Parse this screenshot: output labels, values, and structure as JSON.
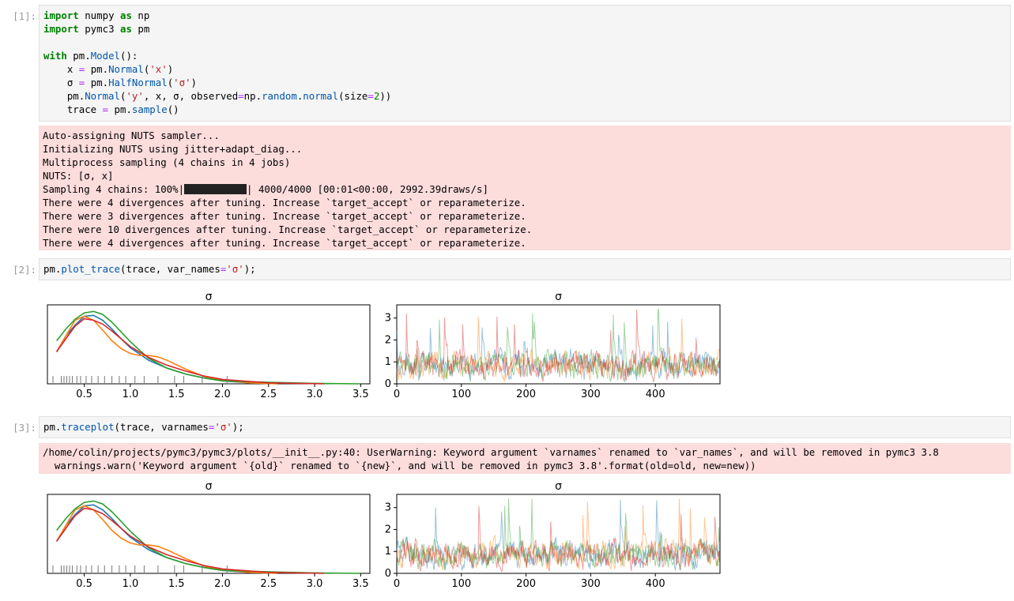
{
  "cells": [
    {
      "prompt": "[1]:",
      "code": [
        "import numpy as np",
        "import pymc3 as pm",
        "",
        "with pm.Model():",
        "    x = pm.Normal('x')",
        "    σ = pm.HalfNormal('σ')",
        "    pm.Normal('y', x, σ, observed=np.random.normal(size=2))",
        "    trace = pm.sample()"
      ],
      "stderr": [
        "Auto-assigning NUTS sampler...",
        "Initializing NUTS using jitter+adapt_diag...",
        "Multiprocess sampling (4 chains in 4 jobs)",
        "NUTS: [σ, x]",
        "Sampling 4 chains: 100%|",
        "| 4000/4000 [00:01<00:00, 2992.39draws/s]",
        "There were 4 divergences after tuning. Increase `target_accept` or reparameterize.",
        "There were 3 divergences after tuning. Increase `target_accept` or reparameterize.",
        "There were 10 divergences after tuning. Increase `target_accept` or reparameterize.",
        "There were 4 divergences after tuning. Increase `target_accept` or reparameterize."
      ]
    },
    {
      "prompt": "[2]:",
      "code": [
        "pm.plot_trace(trace, var_names='σ');"
      ]
    },
    {
      "prompt": "[3]:",
      "code": [
        "pm.traceplot(trace, varnames='σ');"
      ],
      "stderr": [
        "/home/colin/projects/pymc3/pymc3/plots/__init__.py:40: UserWarning: Keyword argument `varnames` renamed to `var_names`, and will be removed in pymc3 3.8",
        "  warnings.warn('Keyword argument `{old}` renamed to `{new}`, and will be removed in pymc3 3.8'.format(old=old, new=new))"
      ]
    }
  ],
  "chart_data": [
    {
      "type": "line",
      "title": "σ",
      "xlabel": "",
      "ylabel": "",
      "xticks": [
        "0.5",
        "1.0",
        "1.5",
        "2.0",
        "2.5",
        "3.0",
        "3.5"
      ],
      "xlim": [
        0.1,
        3.6
      ],
      "series_colors": [
        "#1f77b4",
        "#ff7f0e",
        "#2ca02c",
        "#d62728"
      ],
      "series": [
        {
          "x": [
            0.2,
            0.3,
            0.4,
            0.5,
            0.6,
            0.7,
            0.8,
            0.9,
            1.0,
            1.2,
            1.4,
            1.6,
            1.8,
            2.0,
            2.3,
            2.6
          ],
          "y": [
            0.65,
            0.98,
            1.2,
            1.38,
            1.4,
            1.3,
            1.12,
            0.92,
            0.74,
            0.48,
            0.32,
            0.2,
            0.12,
            0.06,
            0.02,
            0.0
          ]
        },
        {
          "x": [
            0.2,
            0.3,
            0.4,
            0.5,
            0.6,
            0.7,
            0.8,
            0.9,
            1.0,
            1.1,
            1.2,
            1.3,
            1.4,
            1.6,
            1.8,
            2.0,
            2.3,
            2.6
          ],
          "y": [
            0.65,
            0.98,
            1.3,
            1.38,
            1.3,
            1.1,
            0.88,
            0.72,
            0.62,
            0.58,
            0.58,
            0.55,
            0.48,
            0.3,
            0.15,
            0.07,
            0.02,
            0.0
          ]
        },
        {
          "x": [
            0.2,
            0.3,
            0.4,
            0.5,
            0.6,
            0.7,
            0.8,
            0.9,
            1.0,
            1.2,
            1.4,
            1.6,
            1.8,
            2.0,
            2.5,
            3.0,
            3.5
          ],
          "y": [
            0.88,
            1.12,
            1.32,
            1.45,
            1.48,
            1.42,
            1.26,
            1.06,
            0.86,
            0.52,
            0.32,
            0.2,
            0.12,
            0.06,
            0.03,
            0.01,
            0.0
          ]
        },
        {
          "x": [
            0.2,
            0.3,
            0.4,
            0.5,
            0.6,
            0.7,
            0.8,
            0.9,
            1.0,
            1.2,
            1.4,
            1.6,
            1.8,
            2.0,
            2.5,
            3.1
          ],
          "y": [
            0.66,
            0.92,
            1.18,
            1.33,
            1.3,
            1.22,
            1.08,
            0.92,
            0.76,
            0.54,
            0.38,
            0.26,
            0.16,
            0.09,
            0.02,
            0.0
          ]
        }
      ],
      "rug": [
        0.16,
        0.25,
        0.28,
        0.31,
        0.34,
        0.37,
        0.42,
        0.46,
        0.52,
        0.58,
        0.65,
        0.72,
        0.8,
        0.88,
        0.95,
        1.05,
        1.15,
        1.3,
        1.48,
        1.58,
        1.78,
        2.05
      ]
    },
    {
      "type": "line",
      "title": "σ",
      "xlabel": "",
      "ylabel": "",
      "xticks": [
        "0",
        "100",
        "200",
        "300",
        "400"
      ],
      "yticks": [
        "0",
        "1",
        "2",
        "3"
      ],
      "xlim": [
        0,
        500
      ],
      "ylim": [
        0,
        3.6
      ],
      "draws_per_chain": 500,
      "series_colors": [
        "#1f77b4",
        "#ff7f0e",
        "#2ca02c",
        "#d62728"
      ],
      "series_alpha": 0.45
    }
  ]
}
